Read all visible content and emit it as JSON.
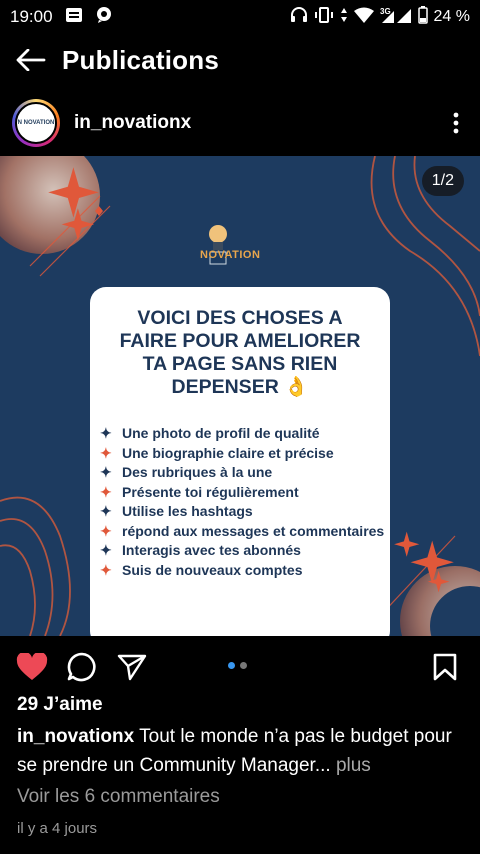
{
  "status_bar": {
    "time": "19:00",
    "battery": "24 %",
    "network": "3G"
  },
  "header": {
    "title": "Publications"
  },
  "post": {
    "username": "in_novationx",
    "avatar_text": "N NOVATION",
    "image_counter": "1/2",
    "image": {
      "logo_text": "NOVATION",
      "card_title_lines": [
        "VOICI DES CHOSES A",
        "FAIRE POUR AMELIORER",
        "TA PAGE SANS RIEN",
        "DEPENSER 👌"
      ],
      "tips": [
        "Une photo de profil de qualité",
        "Une biographie claire et précise",
        "Des rubriques à la une",
        "Présente toi régulièrement",
        "Utilise les hashtags",
        "répond aux messages et commentaires",
        "Interagis avec tes abonnés",
        "Suis de nouveaux comptes"
      ],
      "colors": {
        "background": "#1d3b60",
        "accent": "#e0583a"
      }
    },
    "likes": "29 J’aime",
    "caption_user": "in_novationx",
    "caption_text": "Tout le monde n’a pas le budget pour se prendre un Community  Manager...",
    "caption_more": "plus",
    "view_comments": "Voir les 6 commentaires",
    "timestamp": "il y a 4 jours"
  },
  "icons": {
    "like": "heart-icon",
    "comment": "comment-icon",
    "share": "send-icon",
    "save": "bookmark-icon"
  }
}
